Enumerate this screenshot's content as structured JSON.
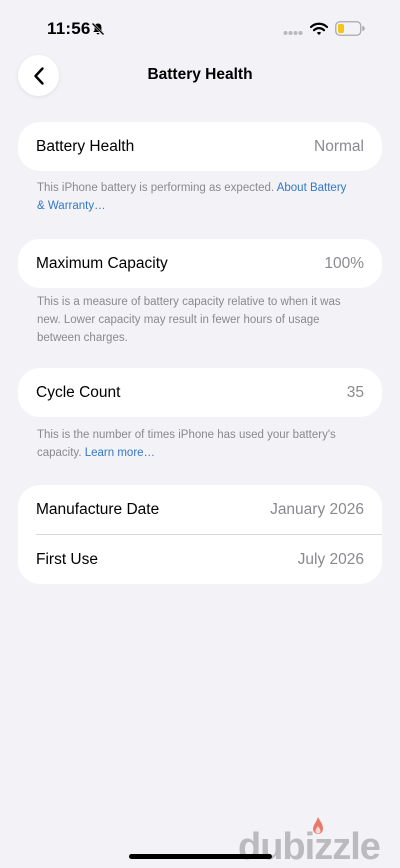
{
  "status_bar": {
    "time": "11:56",
    "icons": [
      "bell-slash-icon",
      "signal-dots-icon",
      "wifi-icon",
      "battery-low-icon"
    ]
  },
  "nav": {
    "title": "Battery Health",
    "back_icon": "chevron-left-icon"
  },
  "sections": {
    "health": {
      "label": "Battery Health",
      "value": "Normal",
      "footnote_text": "This iPhone battery is performing as expected. ",
      "footnote_link": "About Battery & Warranty…"
    },
    "capacity": {
      "label": "Maximum Capacity",
      "value": "100%",
      "footnote_text": "This is a measure of battery capacity relative to when it was new. Lower capacity may result in fewer hours of usage between charges."
    },
    "cycles": {
      "label": "Cycle Count",
      "value": "35",
      "footnote_text": "This is the number of times iPhone has used your battery's capacity. ",
      "footnote_link": "Learn more…"
    },
    "dates": {
      "manufacture_label": "Manufacture Date",
      "manufacture_value": "January 2026",
      "first_use_label": "First Use",
      "first_use_value": "July 2026"
    }
  },
  "watermark": {
    "text": "dubizzle"
  },
  "colors": {
    "background": "#f2f2f7",
    "card": "#ffffff",
    "secondary_text": "#8a8a8e",
    "link": "#3478c6",
    "battery_fill": "#f5c518"
  }
}
